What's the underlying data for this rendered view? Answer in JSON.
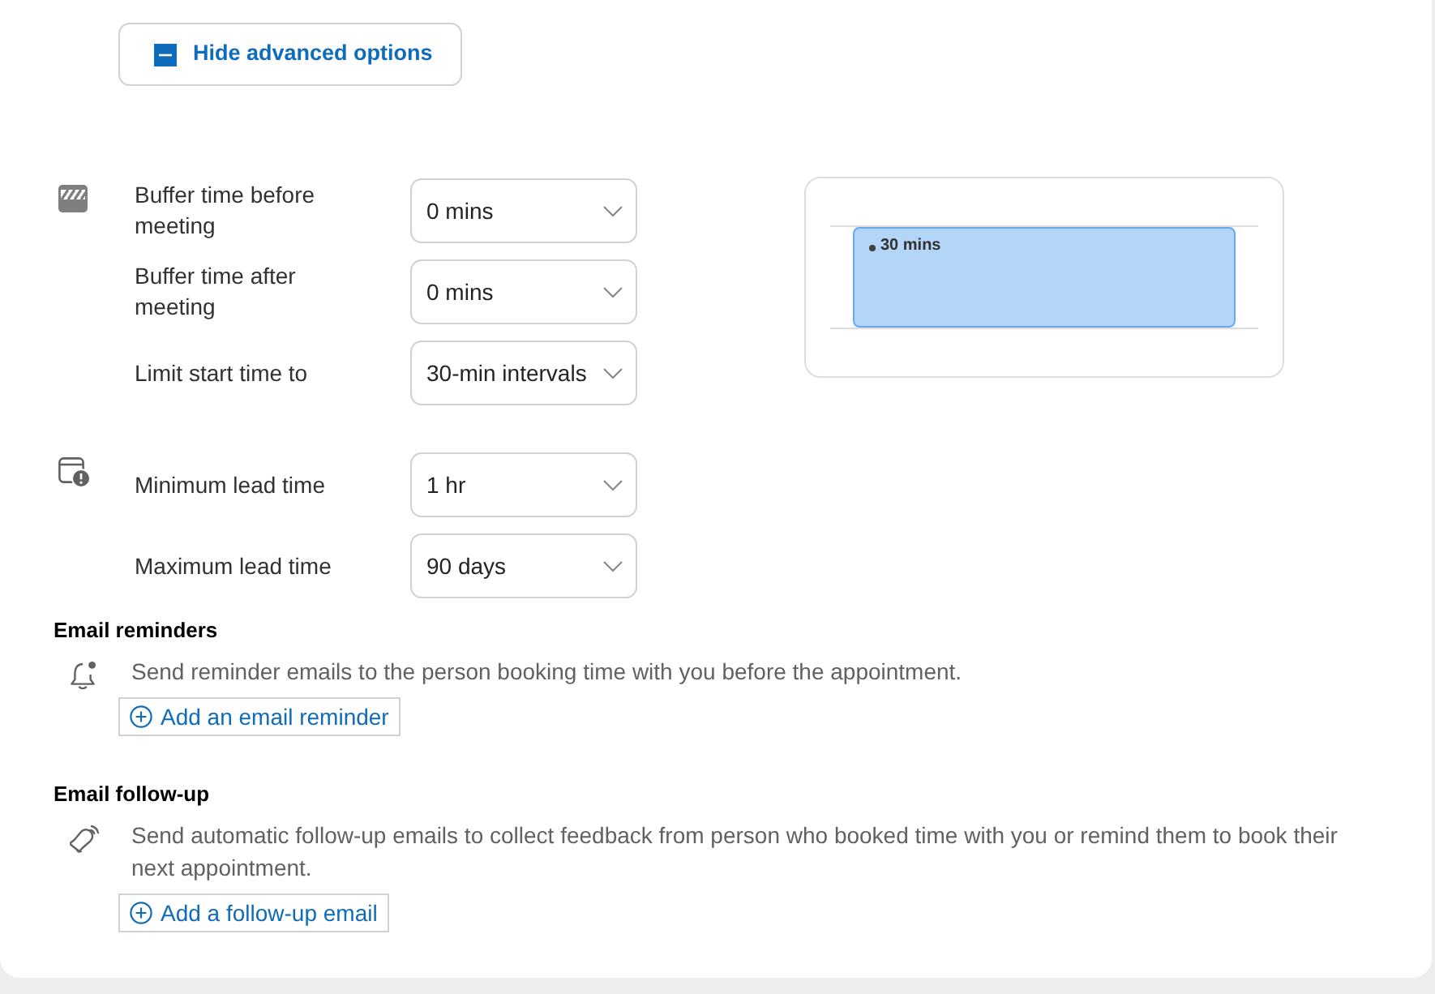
{
  "advanced_toggle": {
    "label": "Hide advanced options",
    "expanded": true
  },
  "buffer_settings": [
    {
      "label": "Buffer time before meeting",
      "value": "0 mins"
    },
    {
      "label": "Buffer time after meeting",
      "value": "0 mins"
    },
    {
      "label": "Limit start time to",
      "value": "30-min intervals"
    }
  ],
  "preview": {
    "event_label": "30 mins"
  },
  "lead_time_settings": [
    {
      "label": "Minimum lead time",
      "value": "1 hr"
    },
    {
      "label": "Maximum lead time",
      "value": "90 days"
    }
  ],
  "email_reminders": {
    "heading": "Email reminders",
    "description": "Send reminder emails to the person booking time with you before the appointment.",
    "button": "Add an email reminder"
  },
  "email_follow_up": {
    "heading": "Email follow-up",
    "description": "Send automatic follow-up emails to collect feedback from person who booked time with you or remind them to book their next appointment.",
    "button": "Add a follow-up email"
  }
}
